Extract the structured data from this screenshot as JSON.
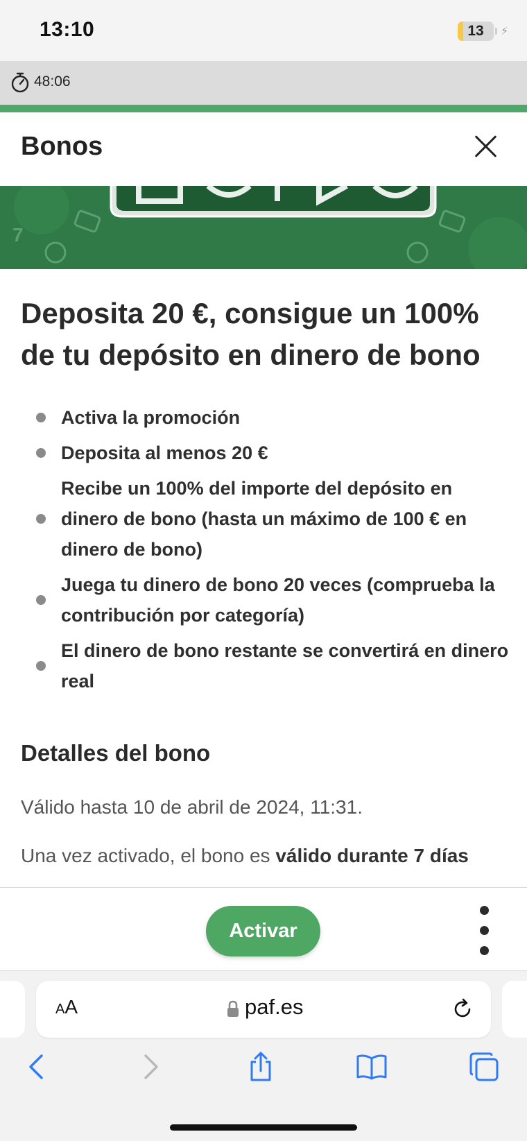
{
  "status_bar": {
    "time": "13:10",
    "battery_level": "13"
  },
  "session": {
    "timer": "48:06"
  },
  "modal": {
    "title": "Bonos",
    "close_icon": "close-icon"
  },
  "promotion": {
    "headline": "Deposita 20 €, consigue un 100% de tu depósito en dinero de bono",
    "steps": [
      "Activa la promoción",
      "Deposita al menos 20 €",
      "Recibe un 100% del importe del depósito en dinero de bono (hasta un máximo de 100 € en dinero de bono)",
      "Juega tu dinero de bono 20 veces (comprueba la contribución por categoría)",
      "El dinero de bono restante se convertirá en dinero real"
    ],
    "details_title": "Detalles del bono",
    "valid_until": "Válido hasta 10 de abril de 2024, 11:31.",
    "validity_prefix": "Una vez activado, el bono es",
    "validity_bold": "válido durante 7 días"
  },
  "actions": {
    "activate_label": "Activar",
    "more_icon": "more-vertical-icon"
  },
  "browser": {
    "text_size_label_small": "A",
    "text_size_label_large": "A",
    "url": "paf.es",
    "icons": [
      "back-icon",
      "forward-icon",
      "share-icon",
      "bookmarks-icon",
      "tabs-icon",
      "reload-icon",
      "lock-icon"
    ]
  },
  "colors": {
    "brand_green": "#4ea864",
    "banner_green": "#2f7a46",
    "battery_low": "#f5c94a"
  }
}
